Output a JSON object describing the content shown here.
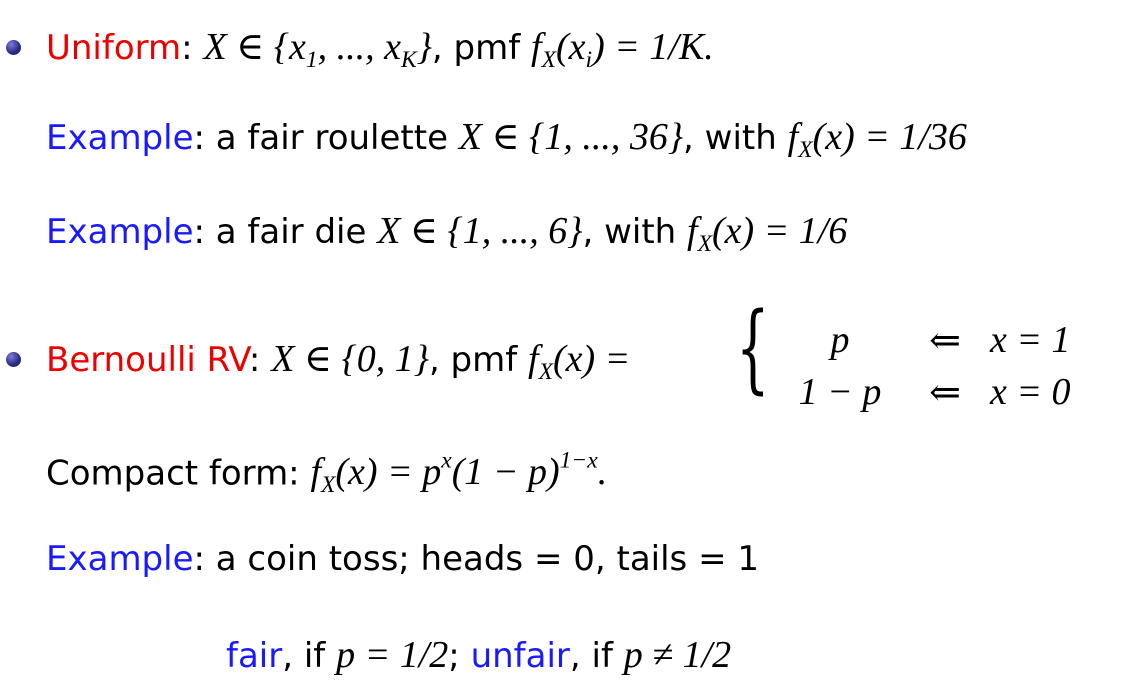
{
  "uniform": {
    "term": "Uniform",
    "colon": ":",
    "math1": "X ∈ {x",
    "sub1": "1",
    "math2": ", ..., x",
    "subK": "K",
    "math3": "}",
    "pmf_text": ", pmf",
    "math4": "f",
    "subX": "X",
    "math5": "(x",
    "subi": "i",
    "math6": ") = 1/K."
  },
  "example1": {
    "label": "Example",
    "text1": ": a fair roulette",
    "math1": "X ∈ {1, ..., 36}",
    "text2": ", with",
    "math2a": "f",
    "subX": "X",
    "math2b": "(x) = 1/36"
  },
  "example2": {
    "label": "Example",
    "text1": ": a fair die",
    "math1": "X ∈ {1, ..., 6}",
    "text2": ", with",
    "math2a": "f",
    "subX": "X",
    "math2b": "(x) = 1/6"
  },
  "bernoulli": {
    "term": "Bernoulli RV",
    "colon": ":",
    "math1": "X ∈ {0, 1}",
    "pmf_text": ", pmf",
    "math2a": "f",
    "subX": "X",
    "math2b": "(x) =",
    "cases": [
      {
        "value": "p",
        "arrow": "⇐",
        "condition": "x = 1"
      },
      {
        "value": "1 − p",
        "arrow": "⇐",
        "condition": "x = 0"
      }
    ]
  },
  "compact": {
    "label": "Compact form:",
    "math_a": "f",
    "subX": "X",
    "math_b": "(x) = p",
    "sup1": "x",
    "math_c": "(1 − p)",
    "sup2": "1−x",
    "math_d": "."
  },
  "example3": {
    "label": "Example",
    "text": ": a coin toss; heads = 0, tails = 1"
  },
  "fairness": {
    "fair": "fair",
    "text1": ", if",
    "math1": "p = 1/2",
    "text2": ";",
    "unfair": "unfair",
    "text3": ", if",
    "math2": "p ≠ 1/2"
  }
}
